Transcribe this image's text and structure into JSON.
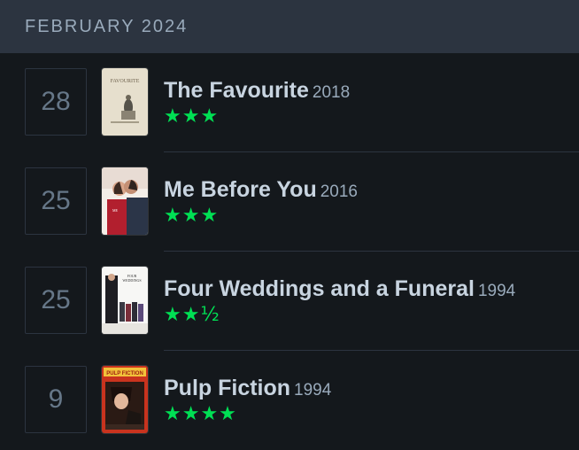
{
  "header": {
    "month": "FEBRUARY 2024"
  },
  "entries": [
    {
      "day": "28",
      "title": "The Favourite",
      "year": "2018",
      "rating": "★★★",
      "poster": "the-favourite-poster",
      "poster_text": "FAVOURITE"
    },
    {
      "day": "25",
      "title": "Me Before You",
      "year": "2016",
      "rating": "★★★",
      "poster": "me-before-you-poster",
      "poster_text": "ME BEFORE YOU"
    },
    {
      "day": "25",
      "title": "Four Weddings and a Funeral",
      "year": "1994",
      "rating": "★★½",
      "poster": "four-weddings-poster",
      "poster_text": "FOUR WEDDINGS AND A FUNERAL"
    },
    {
      "day": "9",
      "title": "Pulp Fiction",
      "year": "1994",
      "rating": "★★★★",
      "poster": "pulp-fiction-poster",
      "poster_text": "PULP FICTION"
    }
  ],
  "colors": {
    "background": "#14181c",
    "header": "#2c3440",
    "star": "#00e054"
  }
}
